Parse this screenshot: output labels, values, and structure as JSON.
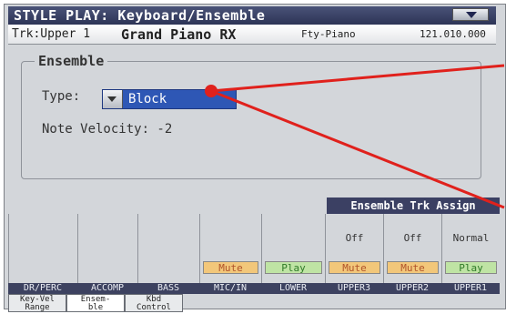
{
  "title": "STYLE PLAY: Keyboard/Ensemble",
  "info": {
    "track": "Trk:Upper 1",
    "sound": "Grand Piano RX",
    "bank": "Fty-Piano",
    "program": "121.010.000"
  },
  "ensemble": {
    "title": "Ensemble",
    "type_label": "Type:",
    "type_value": "Block",
    "velocity_label": "Note Velocity: -2"
  },
  "assign_header": "Ensemble Trk Assign",
  "channels": [
    {
      "name": "DR/PERC",
      "button": "",
      "assign": ""
    },
    {
      "name": "ACCOMP",
      "button": "",
      "assign": ""
    },
    {
      "name": "BASS",
      "button": "",
      "assign": ""
    },
    {
      "name": "MIC/IN",
      "button": "Mute",
      "assign": ""
    },
    {
      "name": "LOWER",
      "button": "Play",
      "assign": ""
    },
    {
      "name": "UPPER3",
      "button": "Mute",
      "assign": "Off"
    },
    {
      "name": "UPPER2",
      "button": "Mute",
      "assign": "Off"
    },
    {
      "name": "UPPER1",
      "button": "Play",
      "assign": "Normal"
    }
  ],
  "tabs": [
    {
      "label": "Key-Vel\nRange"
    },
    {
      "label": "Ensem-\nble"
    },
    {
      "label": "Kbd\nControl"
    }
  ],
  "colors": {
    "titlebar": "#2d3456",
    "selection": "#2e57b5",
    "mute": "#f2c77a",
    "play": "#bfe4a4",
    "arrow": "#e0211c"
  }
}
